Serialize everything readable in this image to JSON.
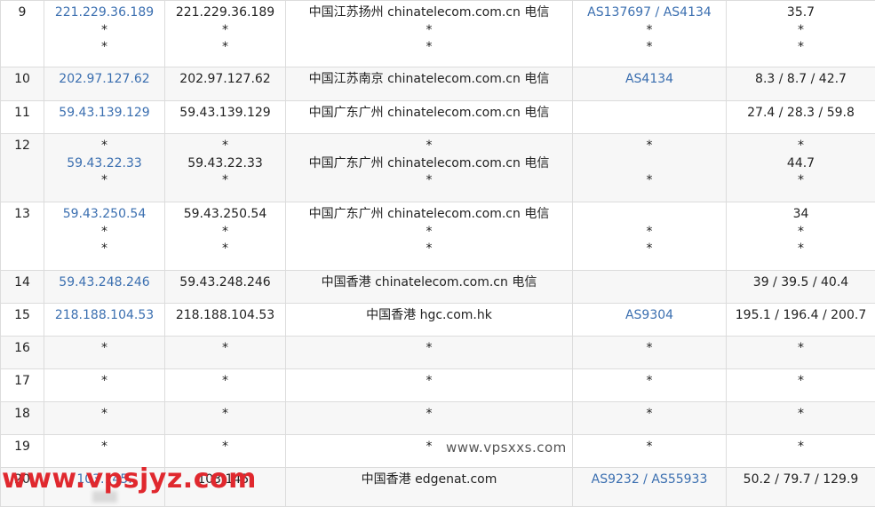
{
  "rows": [
    {
      "hop": "9",
      "ip_link": [
        "221.229.36.189",
        "*",
        "*"
      ],
      "ip": [
        "221.229.36.189",
        "*",
        "*"
      ],
      "geo": [
        "中国江苏扬州 chinatelecom.com.cn 电信",
        "*",
        "*"
      ],
      "asn": [
        [
          "AS137697",
          "AS4134"
        ],
        [
          "*"
        ],
        [
          "*"
        ]
      ],
      "rtt": [
        "35.7",
        "*",
        "*"
      ]
    },
    {
      "hop": "10",
      "ip_link": [
        "202.97.127.62"
      ],
      "ip": [
        "202.97.127.62"
      ],
      "geo": [
        "中国江苏南京 chinatelecom.com.cn 电信"
      ],
      "asn": [
        [
          "AS4134"
        ]
      ],
      "rtt": [
        "8.3 / 8.7 / 42.7"
      ]
    },
    {
      "hop": "11",
      "ip_link": [
        "59.43.139.129"
      ],
      "ip": [
        "59.43.139.129"
      ],
      "geo": [
        "中国广东广州 chinatelecom.com.cn 电信"
      ],
      "asn": [
        []
      ],
      "rtt": [
        "27.4 / 28.3 / 59.8"
      ]
    },
    {
      "hop": "12",
      "ip_link": [
        "*",
        "59.43.22.33",
        "*"
      ],
      "ip": [
        "*",
        "59.43.22.33",
        "*"
      ],
      "geo": [
        "*",
        "中国广东广州 chinatelecom.com.cn 电信",
        "*"
      ],
      "asn": [
        [
          "*"
        ],
        [],
        [
          "*"
        ]
      ],
      "rtt": [
        "*",
        "44.7",
        "*"
      ]
    },
    {
      "hop": "13",
      "ip_link": [
        "59.43.250.54",
        "*",
        "*"
      ],
      "ip": [
        "59.43.250.54",
        "*",
        "*"
      ],
      "geo": [
        "中国广东广州 chinatelecom.com.cn 电信",
        "*",
        "*"
      ],
      "asn": [
        [],
        [
          "*"
        ],
        [
          "*"
        ]
      ],
      "rtt": [
        "34",
        "*",
        "*"
      ]
    },
    {
      "hop": "14",
      "ip_link": [
        "59.43.248.246"
      ],
      "ip": [
        "59.43.248.246"
      ],
      "geo": [
        "中国香港 chinatelecom.com.cn 电信"
      ],
      "asn": [
        []
      ],
      "rtt": [
        "39 / 39.5 / 40.4"
      ]
    },
    {
      "hop": "15",
      "ip_link": [
        "218.188.104.53"
      ],
      "ip": [
        "218.188.104.53"
      ],
      "geo": [
        "中国香港 hgc.com.hk"
      ],
      "asn": [
        [
          "AS9304"
        ]
      ],
      "rtt": [
        "195.1 / 196.4 / 200.7"
      ]
    },
    {
      "hop": "16",
      "ip_link": [
        "*"
      ],
      "ip": [
        "*"
      ],
      "geo": [
        "*"
      ],
      "asn": [
        [
          "*"
        ]
      ],
      "rtt": [
        "*"
      ]
    },
    {
      "hop": "17",
      "ip_link": [
        "*"
      ],
      "ip": [
        "*"
      ],
      "geo": [
        "*"
      ],
      "asn": [
        [
          "*"
        ]
      ],
      "rtt": [
        "*"
      ]
    },
    {
      "hop": "18",
      "ip_link": [
        "*"
      ],
      "ip": [
        "*"
      ],
      "geo": [
        "*"
      ],
      "asn": [
        [
          "*"
        ]
      ],
      "rtt": [
        "*"
      ]
    },
    {
      "hop": "19",
      "ip_link": [
        "*"
      ],
      "ip": [
        "*"
      ],
      "geo": [
        "*"
      ],
      "asn": [
        [
          "*"
        ]
      ],
      "rtt": [
        "*"
      ]
    },
    {
      "hop": "20",
      "ip_link": [
        "103.145."
      ],
      "ip": [
        "103.145."
      ],
      "geo": [
        "中国香港 edgenat.com"
      ],
      "asn": [
        [
          "AS9232",
          "AS55933"
        ]
      ],
      "rtt": [
        "50.2 / 79.7 / 129.9"
      ],
      "redacted": true
    }
  ],
  "watermarks": {
    "center": "www.vpsxxs.com",
    "overlay": "www.vpsjyz.com"
  },
  "colors": {
    "link": "#3b6fb0",
    "border": "#dcdcdc",
    "stripe": "#f7f7f7",
    "watermark_red": "#e0282e"
  }
}
